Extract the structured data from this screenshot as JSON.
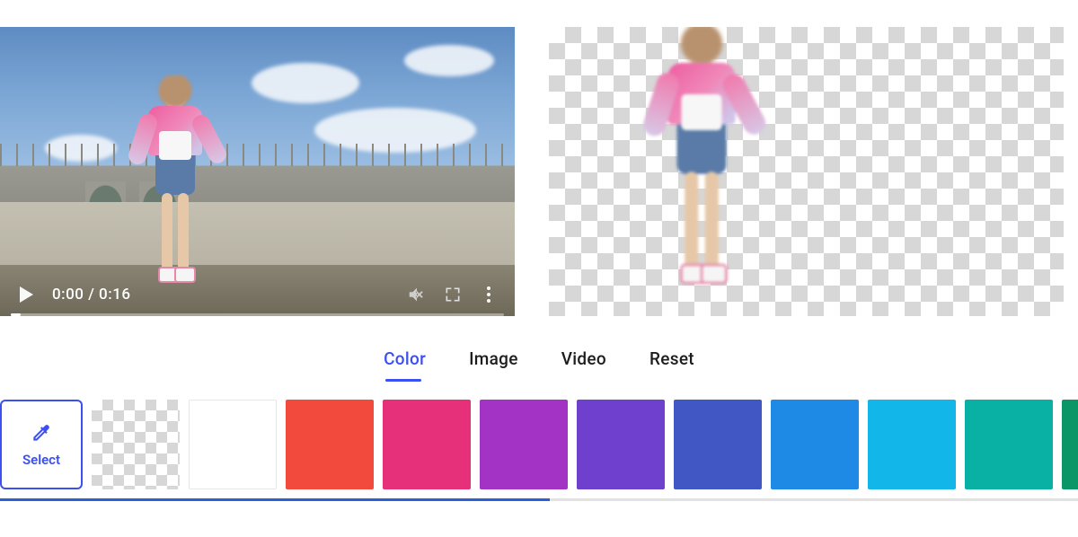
{
  "video": {
    "current_time": "0:00",
    "duration": "0:16",
    "time_display": "0:00 / 0:16",
    "progress_percent": 2
  },
  "tabs": [
    {
      "label": "Color",
      "active": true
    },
    {
      "label": "Image",
      "active": false
    },
    {
      "label": "Video",
      "active": false
    },
    {
      "label": "Reset",
      "active": false
    }
  ],
  "select_button": {
    "label": "Select",
    "icon": "eyedropper-icon"
  },
  "swatches": [
    {
      "type": "checker",
      "name": "transparent"
    },
    {
      "type": "white",
      "name": "white",
      "hex": "#ffffff"
    },
    {
      "type": "color",
      "hex": "#f24a3d"
    },
    {
      "type": "color",
      "hex": "#e6317a"
    },
    {
      "type": "color",
      "hex": "#a233c4"
    },
    {
      "type": "color",
      "hex": "#6f3fce"
    },
    {
      "type": "color",
      "hex": "#4158c4"
    },
    {
      "type": "color",
      "hex": "#1f8ae6"
    },
    {
      "type": "color",
      "hex": "#12b6e8"
    },
    {
      "type": "color",
      "hex": "#08b1a4"
    },
    {
      "type": "color",
      "hex": "#0a9666"
    }
  ],
  "scroll": {
    "thumb_percent": 51
  }
}
